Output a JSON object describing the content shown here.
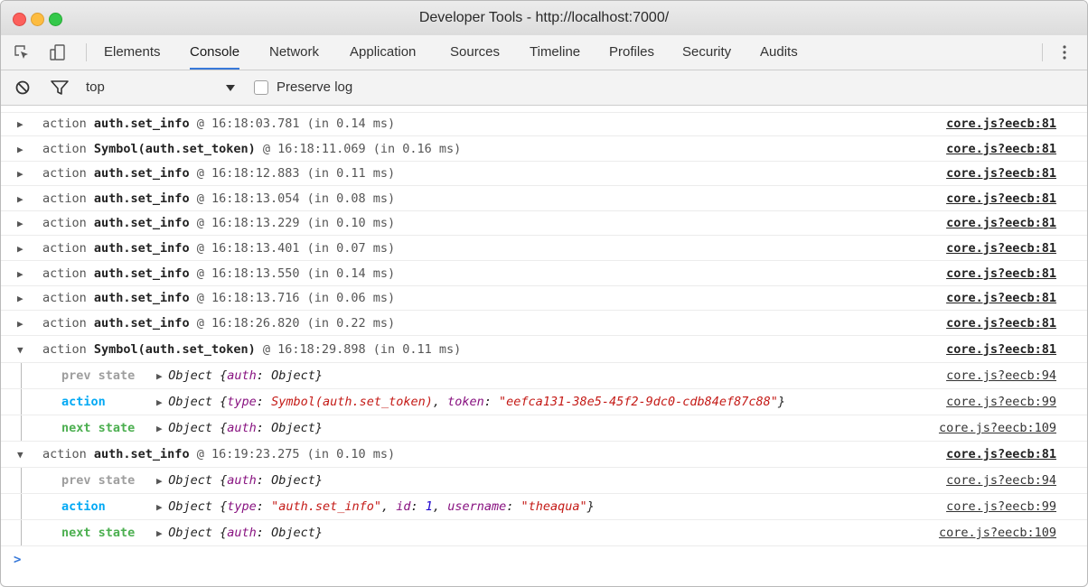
{
  "window": {
    "title": "Developer Tools - http://localhost:7000/"
  },
  "tabs": [
    "Elements",
    "Console",
    "Network",
    "Application",
    "Sources",
    "Timeline",
    "Profiles",
    "Security",
    "Audits"
  ],
  "filter": {
    "context": "top",
    "preserve_log_label": "Preserve log",
    "preserve_log_checked": false
  },
  "icons": {
    "inspect": "inspect-element-icon",
    "device": "device-toolbar-icon",
    "clear": "clear-console-icon",
    "filter": "filter-icon",
    "dropdown": "dropdown-arrow-icon",
    "more": "more-vertical-icon"
  },
  "colors": {
    "tab_active": "#3879d9",
    "prev_state": "#9e9e9e",
    "action": "#03a9f4",
    "next_state": "#4caf50",
    "string": "#c41a16",
    "key": "#881280",
    "number": "#1c00cf"
  },
  "console": {
    "collapsed_rows": [
      {
        "prefix": "action ",
        "name": "auth.set_info",
        "suffix": " @ 16:18:03.781 (in 0.14 ms)",
        "source": "core.js?eecb:81"
      },
      {
        "prefix": "action ",
        "name": "Symbol(auth.set_token)",
        "suffix": " @ 16:18:11.069 (in 0.16 ms)",
        "source": "core.js?eecb:81"
      },
      {
        "prefix": "action ",
        "name": "auth.set_info",
        "suffix": " @ 16:18:12.883 (in 0.11 ms)",
        "source": "core.js?eecb:81"
      },
      {
        "prefix": "action ",
        "name": "auth.set_info",
        "suffix": " @ 16:18:13.054 (in 0.08 ms)",
        "source": "core.js?eecb:81"
      },
      {
        "prefix": "action ",
        "name": "auth.set_info",
        "suffix": " @ 16:18:13.229 (in 0.10 ms)",
        "source": "core.js?eecb:81"
      },
      {
        "prefix": "action ",
        "name": "auth.set_info",
        "suffix": " @ 16:18:13.401 (in 0.07 ms)",
        "source": "core.js?eecb:81"
      },
      {
        "prefix": "action ",
        "name": "auth.set_info",
        "suffix": " @ 16:18:13.550 (in 0.14 ms)",
        "source": "core.js?eecb:81"
      },
      {
        "prefix": "action ",
        "name": "auth.set_info",
        "suffix": " @ 16:18:13.716 (in 0.06 ms)",
        "source": "core.js?eecb:81"
      },
      {
        "prefix": "action ",
        "name": "auth.set_info",
        "suffix": " @ 16:18:26.820 (in 0.22 ms)",
        "source": "core.js?eecb:81"
      }
    ],
    "group1": {
      "prefix": "action ",
      "name": "Symbol(auth.set_token)",
      "suffix": " @ 16:18:29.898 (in 0.11 ms)",
      "source": "core.js?eecb:81",
      "prev": {
        "label": "prev state",
        "obj_head": "Object {",
        "k1": "auth",
        "v1": "Object",
        "tail": "}",
        "source": "core.js?eecb:94"
      },
      "action": {
        "label": "action",
        "obj_head": "Object {",
        "k1": "type",
        "v1": "Symbol(auth.set_token)",
        "k2": "token",
        "v2": "\"eefca131-38e5-45f2-9dc0-cdb84ef87c88\"",
        "tail": "}",
        "source": "core.js?eecb:99"
      },
      "next": {
        "label": "next state",
        "obj_head": "Object {",
        "k1": "auth",
        "v1": "Object",
        "tail": "}",
        "source": "core.js?eecb:109"
      }
    },
    "group2": {
      "prefix": "action ",
      "name": "auth.set_info",
      "suffix": " @ 16:19:23.275 (in 0.10 ms)",
      "source": "core.js?eecb:81",
      "prev": {
        "label": "prev state",
        "obj_head": "Object {",
        "k1": "auth",
        "v1": "Object",
        "tail": "}",
        "source": "core.js?eecb:94"
      },
      "action": {
        "label": "action",
        "obj_head": "Object {",
        "k1": "type",
        "v1": "\"auth.set_info\"",
        "k2": "id",
        "v2": "1",
        "k3": "username",
        "v3": "\"theaqua\"",
        "tail": "}",
        "source": "core.js?eecb:99"
      },
      "next": {
        "label": "next state",
        "obj_head": "Object {",
        "k1": "auth",
        "v1": "Object",
        "tail": "}",
        "source": "core.js?eecb:109"
      }
    },
    "prompt": ">"
  }
}
